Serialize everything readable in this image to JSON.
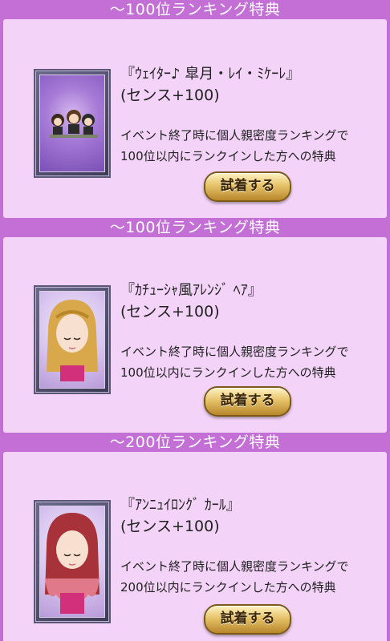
{
  "sections": [
    {
      "header": "〜100位ランキング特典",
      "title": "『ｳｪｲﾀｰ♪ 皐月・ﾚｲ・ﾐｹｰﾚ』",
      "bonus": "(センス+100)",
      "desc_line1": "イベント終了時に個人親密度ランキングで",
      "desc_line2": "100位以内にランクインした方への特典",
      "button": "試着する"
    },
    {
      "header": "〜100位ランキング特典",
      "title": "『ｶﾁｭｰｼｬ風ｱﾚﾝｼﾞ ﾍｱ』",
      "bonus": "(センス+100)",
      "desc_line1": "イベント終了時に個人親密度ランキングで",
      "desc_line2": "100位以内にランクインした方への特典",
      "button": "試着する"
    },
    {
      "header": "〜200位ランキング特典",
      "title": "『ｱﾝﾆｭｲﾛﾝｸﾞ ｶｰﾙ』",
      "bonus": "(センス+100)",
      "desc_line1": "イベント終了時に個人親密度ランキングで",
      "desc_line2": "200位以内にランクインした方への特典",
      "button": "試着する"
    }
  ],
  "colors": {
    "header_bg": "#c36fd6",
    "panel_bg": "#f3d3f8",
    "button_gold": "#e6c36a"
  }
}
